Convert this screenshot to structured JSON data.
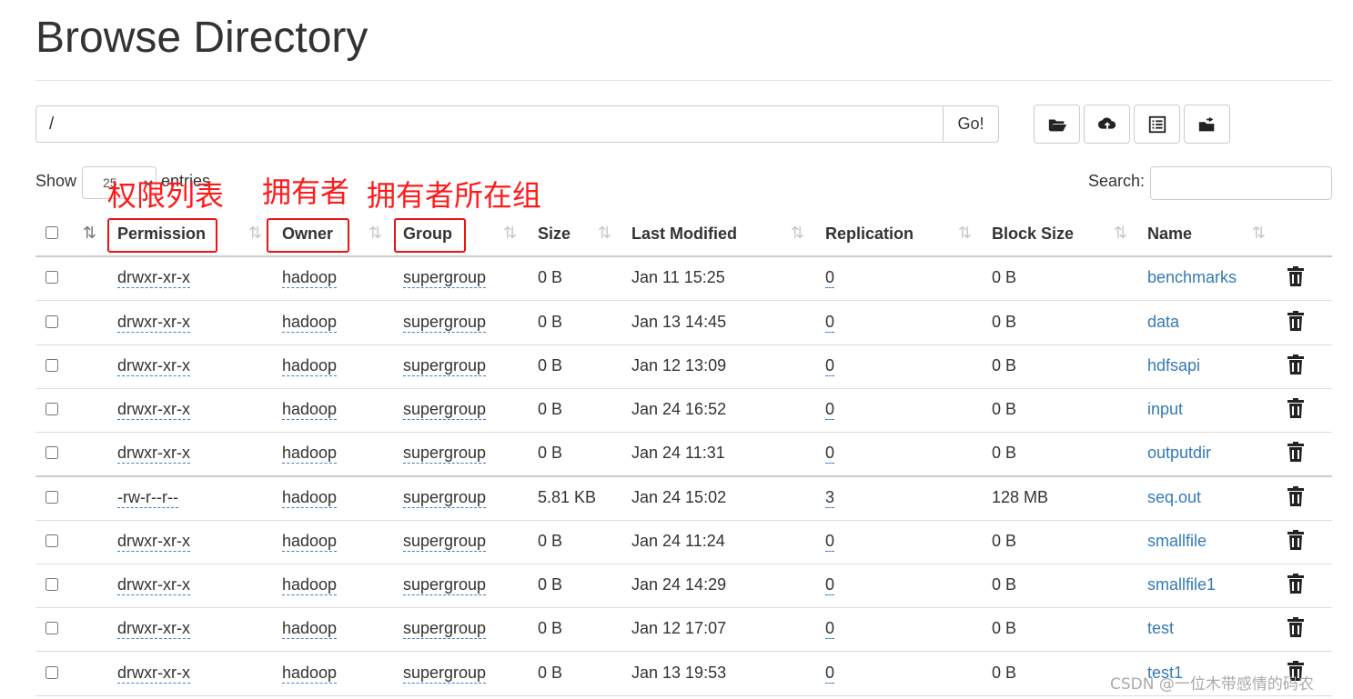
{
  "page": {
    "title": "Browse Directory"
  },
  "pathbar": {
    "value": "/",
    "go_label": "Go!"
  },
  "toolbar": {
    "icons": [
      "folder-open-icon",
      "cloud-upload-icon",
      "list-icon",
      "folder-arrow-icon"
    ]
  },
  "controls": {
    "show_label": "Show",
    "entries_value": "25",
    "entries_label": "entries",
    "search_label": "Search:",
    "search_value": ""
  },
  "annotations": {
    "permission": "权限列表",
    "owner": "拥有者",
    "group": "拥有者所在组"
  },
  "columns": {
    "permission": "Permission",
    "owner": "Owner",
    "group": "Group",
    "size": "Size",
    "last_modified": "Last Modified",
    "replication": "Replication",
    "block_size": "Block Size",
    "name": "Name"
  },
  "rows": [
    {
      "permission": "drwxr-xr-x",
      "owner": "hadoop",
      "group": "supergroup",
      "size": "0 B",
      "last_modified": "Jan 11 15:25",
      "replication": "0",
      "block_size": "0 B",
      "name": "benchmarks"
    },
    {
      "permission": "drwxr-xr-x",
      "owner": "hadoop",
      "group": "supergroup",
      "size": "0 B",
      "last_modified": "Jan 13 14:45",
      "replication": "0",
      "block_size": "0 B",
      "name": "data"
    },
    {
      "permission": "drwxr-xr-x",
      "owner": "hadoop",
      "group": "supergroup",
      "size": "0 B",
      "last_modified": "Jan 12 13:09",
      "replication": "0",
      "block_size": "0 B",
      "name": "hdfsapi"
    },
    {
      "permission": "drwxr-xr-x",
      "owner": "hadoop",
      "group": "supergroup",
      "size": "0 B",
      "last_modified": "Jan 24 16:52",
      "replication": "0",
      "block_size": "0 B",
      "name": "input"
    },
    {
      "permission": "drwxr-xr-x",
      "owner": "hadoop",
      "group": "supergroup",
      "size": "0 B",
      "last_modified": "Jan 24 11:31",
      "replication": "0",
      "block_size": "0 B",
      "name": "outputdir"
    },
    {
      "permission": "-rw-r--r--",
      "owner": "hadoop",
      "group": "supergroup",
      "size": "5.81 KB",
      "last_modified": "Jan 24 15:02",
      "replication": "3",
      "block_size": "128 MB",
      "name": "seq.out"
    },
    {
      "permission": "drwxr-xr-x",
      "owner": "hadoop",
      "group": "supergroup",
      "size": "0 B",
      "last_modified": "Jan 24 11:24",
      "replication": "0",
      "block_size": "0 B",
      "name": "smallfile"
    },
    {
      "permission": "drwxr-xr-x",
      "owner": "hadoop",
      "group": "supergroup",
      "size": "0 B",
      "last_modified": "Jan 24 14:29",
      "replication": "0",
      "block_size": "0 B",
      "name": "smallfile1"
    },
    {
      "permission": "drwxr-xr-x",
      "owner": "hadoop",
      "group": "supergroup",
      "size": "0 B",
      "last_modified": "Jan 12 17:07",
      "replication": "0",
      "block_size": "0 B",
      "name": "test"
    },
    {
      "permission": "drwxr-xr-x",
      "owner": "hadoop",
      "group": "supergroup",
      "size": "0 B",
      "last_modified": "Jan 13 19:53",
      "replication": "0",
      "block_size": "0 B",
      "name": "test1"
    }
  ],
  "watermark": "CSDN @一位木带感情的码农",
  "colors": {
    "link": "#337ab7",
    "annotation": "#ff1a1a",
    "border": "#cccccc"
  }
}
